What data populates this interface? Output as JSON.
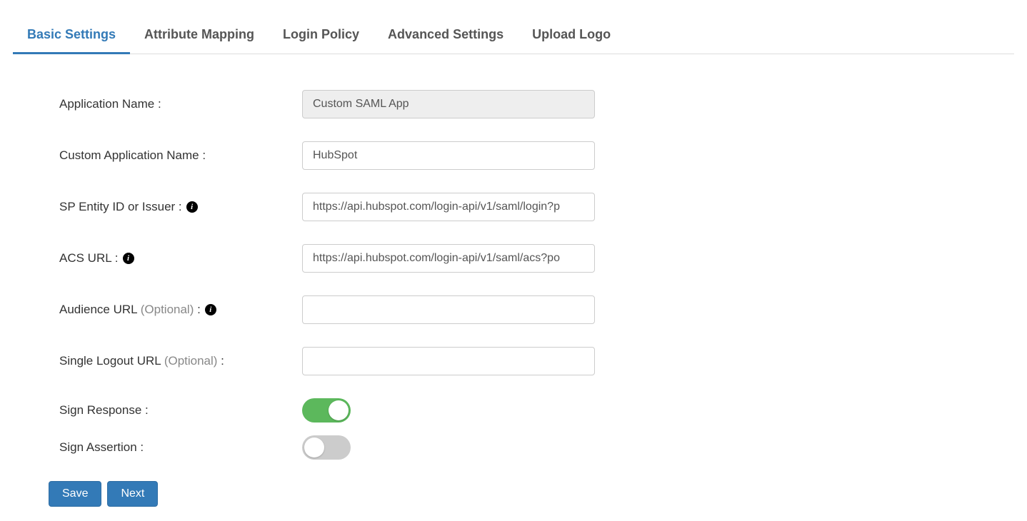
{
  "tabs": [
    {
      "label": "Basic Settings",
      "active": true
    },
    {
      "label": "Attribute Mapping",
      "active": false
    },
    {
      "label": "Login Policy",
      "active": false
    },
    {
      "label": "Advanced Settings",
      "active": false
    },
    {
      "label": "Upload Logo",
      "active": false
    }
  ],
  "form": {
    "application_name": {
      "label": "Application Name :",
      "value": "Custom SAML App"
    },
    "custom_application_name": {
      "label": "Custom Application Name :",
      "value": "HubSpot"
    },
    "sp_entity_id": {
      "label_pre": "SP Entity ID or Issuer :",
      "value": "https://api.hubspot.com/login-api/v1/saml/login?p"
    },
    "acs_url": {
      "label_pre": "ACS URL :",
      "value": "https://api.hubspot.com/login-api/v1/saml/acs?po"
    },
    "audience_url": {
      "label_pre": "Audience URL",
      "optional": "(Optional)",
      "label_post": " :",
      "value": ""
    },
    "single_logout_url": {
      "label_pre": "Single Logout URL",
      "optional": "(Optional)",
      "label_post": " :",
      "value": ""
    },
    "sign_response": {
      "label": "Sign Response :",
      "value": true
    },
    "sign_assertion": {
      "label": "Sign Assertion :",
      "value": false
    }
  },
  "buttons": {
    "save": "Save",
    "next": "Next"
  }
}
